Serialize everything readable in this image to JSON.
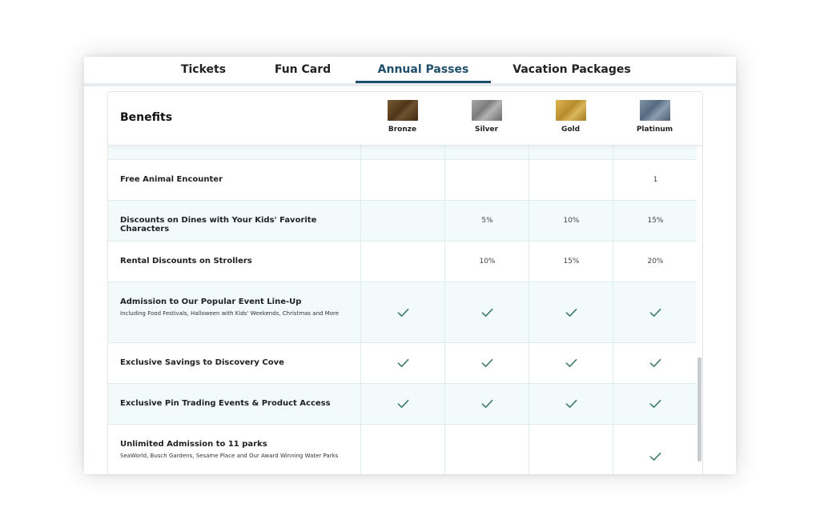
{
  "tabs": [
    {
      "label": "Tickets",
      "active": false
    },
    {
      "label": "Fun Card",
      "active": false
    },
    {
      "label": "Annual Passes",
      "active": true
    },
    {
      "label": "Vacation Packages",
      "active": false
    }
  ],
  "table": {
    "title": "Benefits",
    "tiers": [
      {
        "label": "Bronze",
        "color": "#5e4424"
      },
      {
        "label": "Silver",
        "color": "#8e8e8e"
      },
      {
        "label": "Gold",
        "color": "#c9a23f"
      },
      {
        "label": "Platinum",
        "color": "#64788c"
      }
    ],
    "rows": [
      {
        "label": "",
        "sub": "",
        "values": [
          "",
          "",
          "",
          ""
        ]
      },
      {
        "label": "Free Animal Encounter",
        "sub": "",
        "values": [
          "",
          "",
          "",
          "1"
        ]
      },
      {
        "label": "Discounts on Dines with Your Kids' Favorite Characters",
        "sub": "",
        "values": [
          "",
          "5%",
          "10%",
          "15%"
        ]
      },
      {
        "label": "Rental Discounts on Strollers",
        "sub": "",
        "values": [
          "",
          "10%",
          "15%",
          "20%"
        ]
      },
      {
        "label": "Admission to Our Popular Event Line-Up",
        "sub": "Including Food Festivals, Halloween with Kids' Weekends, Christmas and More",
        "values": [
          "check",
          "check",
          "check",
          "check"
        ]
      },
      {
        "label": "Exclusive Savings to Discovery Cove",
        "sub": "",
        "values": [
          "check",
          "check",
          "check",
          "check"
        ]
      },
      {
        "label": "Exclusive Pin Trading Events & Product Access",
        "sub": "",
        "values": [
          "check",
          "check",
          "check",
          "check"
        ]
      },
      {
        "label": "Unlimited Admission to 11 parks",
        "sub": "SeaWorld, Busch Gardens, Sesame Place and Our Award Winning Water Parks",
        "values": [
          "",
          "",
          "",
          "check"
        ]
      }
    ]
  },
  "icons": {
    "check": "check-icon",
    "check_color": "#3f7b69"
  }
}
